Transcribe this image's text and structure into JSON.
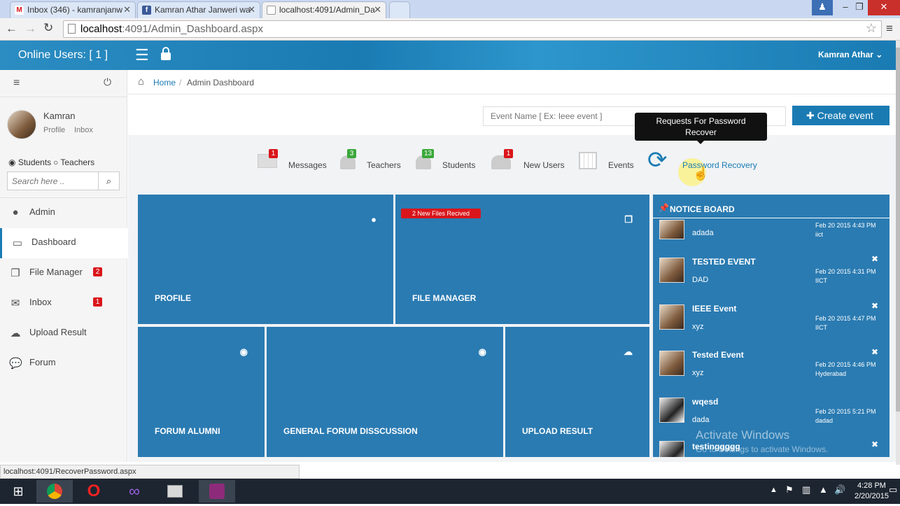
{
  "browser": {
    "tabs": [
      {
        "title": "Inbox (346) - kamranjanw",
        "icon": "gmail-icon"
      },
      {
        "title": "Kamran Athar Janweri wa",
        "icon": "facebook-icon"
      },
      {
        "title": "localhost:4091/Admin_Da",
        "icon": "page-icon"
      }
    ],
    "url_host": "localhost",
    "url_path": ":4091/Admin_Dashboard.aspx"
  },
  "header": {
    "online_users": "Online Users: [ 1 ]",
    "user_name": "Kamran Athar"
  },
  "sidebar": {
    "profile_name": "Kamran",
    "profile_link": "Profile",
    "inbox_link": "Inbox",
    "radio_students": "Students",
    "radio_teachers": "Teachers",
    "search_placeholder": "Search here ..",
    "items": [
      {
        "label": "Admin",
        "icon": "user-icon"
      },
      {
        "label": "Dashboard",
        "icon": "monitor-icon"
      },
      {
        "label": "File Manager",
        "icon": "files-icon",
        "badge": "2"
      },
      {
        "label": "Inbox",
        "icon": "envelope-icon",
        "badge": "1"
      },
      {
        "label": "Upload Result",
        "icon": "cloud-upload-icon"
      },
      {
        "label": "Forum",
        "icon": "comments-icon"
      }
    ]
  },
  "breadcrumb": {
    "home": "Home",
    "separator": "/",
    "current": "Admin Dashboard"
  },
  "event": {
    "placeholder": "Event Name [ Ex: Ieee event ]",
    "button": "Create event"
  },
  "tooltip": "Requests For Password Recover",
  "stats": [
    {
      "label": "Messages",
      "badge": "1",
      "badge_color": "#d9161b"
    },
    {
      "label": "Teachers",
      "badge": "3",
      "badge_color": "#3aa83a"
    },
    {
      "label": "Students",
      "badge": "13",
      "badge_color": "#3aa83a"
    },
    {
      "label": "New Users",
      "badge": "1",
      "badge_color": "#d9161b"
    },
    {
      "label": "Events",
      "badge": ""
    },
    {
      "label": "Password Recovery",
      "badge": ""
    }
  ],
  "tiles": {
    "profile": "PROFILE",
    "file_manager": "FILE MANAGER",
    "file_manager_badge": "2 New Files Recived",
    "forum_alumni": "FORUM ALUMNI",
    "general_forum": "GENERAL FORUM DISSCUSSION",
    "upload_result": "UPLOAD RESULT"
  },
  "notice_board": {
    "title": "NOTICE BOARD",
    "items": [
      {
        "title": "",
        "sub": "adada",
        "date": "Feb 20 2015 4:43 PM",
        "place": "iict"
      },
      {
        "title": "TESTED EVENT",
        "sub": "DAD",
        "date": "Feb 20 2015 4:31 PM",
        "place": "IICT"
      },
      {
        "title": "IEEE Event",
        "sub": "xyz",
        "date": "Feb 20 2015 4:47 PM",
        "place": "IICT"
      },
      {
        "title": "Tested Event",
        "sub": "xyz",
        "date": "Feb 20 2015 4:46 PM",
        "place": "Hyderabad"
      },
      {
        "title": "wqesd",
        "sub": "dada",
        "date": "Feb 20 2015 5:21 PM",
        "place": "dadad"
      },
      {
        "title": "testinggggg",
        "sub": "",
        "date": "",
        "place": ""
      }
    ]
  },
  "watermark": {
    "line1": "Activate Windows",
    "line2": "Go to Settings to activate Windows."
  },
  "status_url": "localhost:4091/RecoverPassword.aspx",
  "taskbar": {
    "time": "4:28 PM",
    "date": "2/20/2015"
  },
  "colors": {
    "accent": "#1a7bb3",
    "tile": "#2a7bb2",
    "badge_red": "#d9161b",
    "badge_green": "#3aa83a"
  }
}
